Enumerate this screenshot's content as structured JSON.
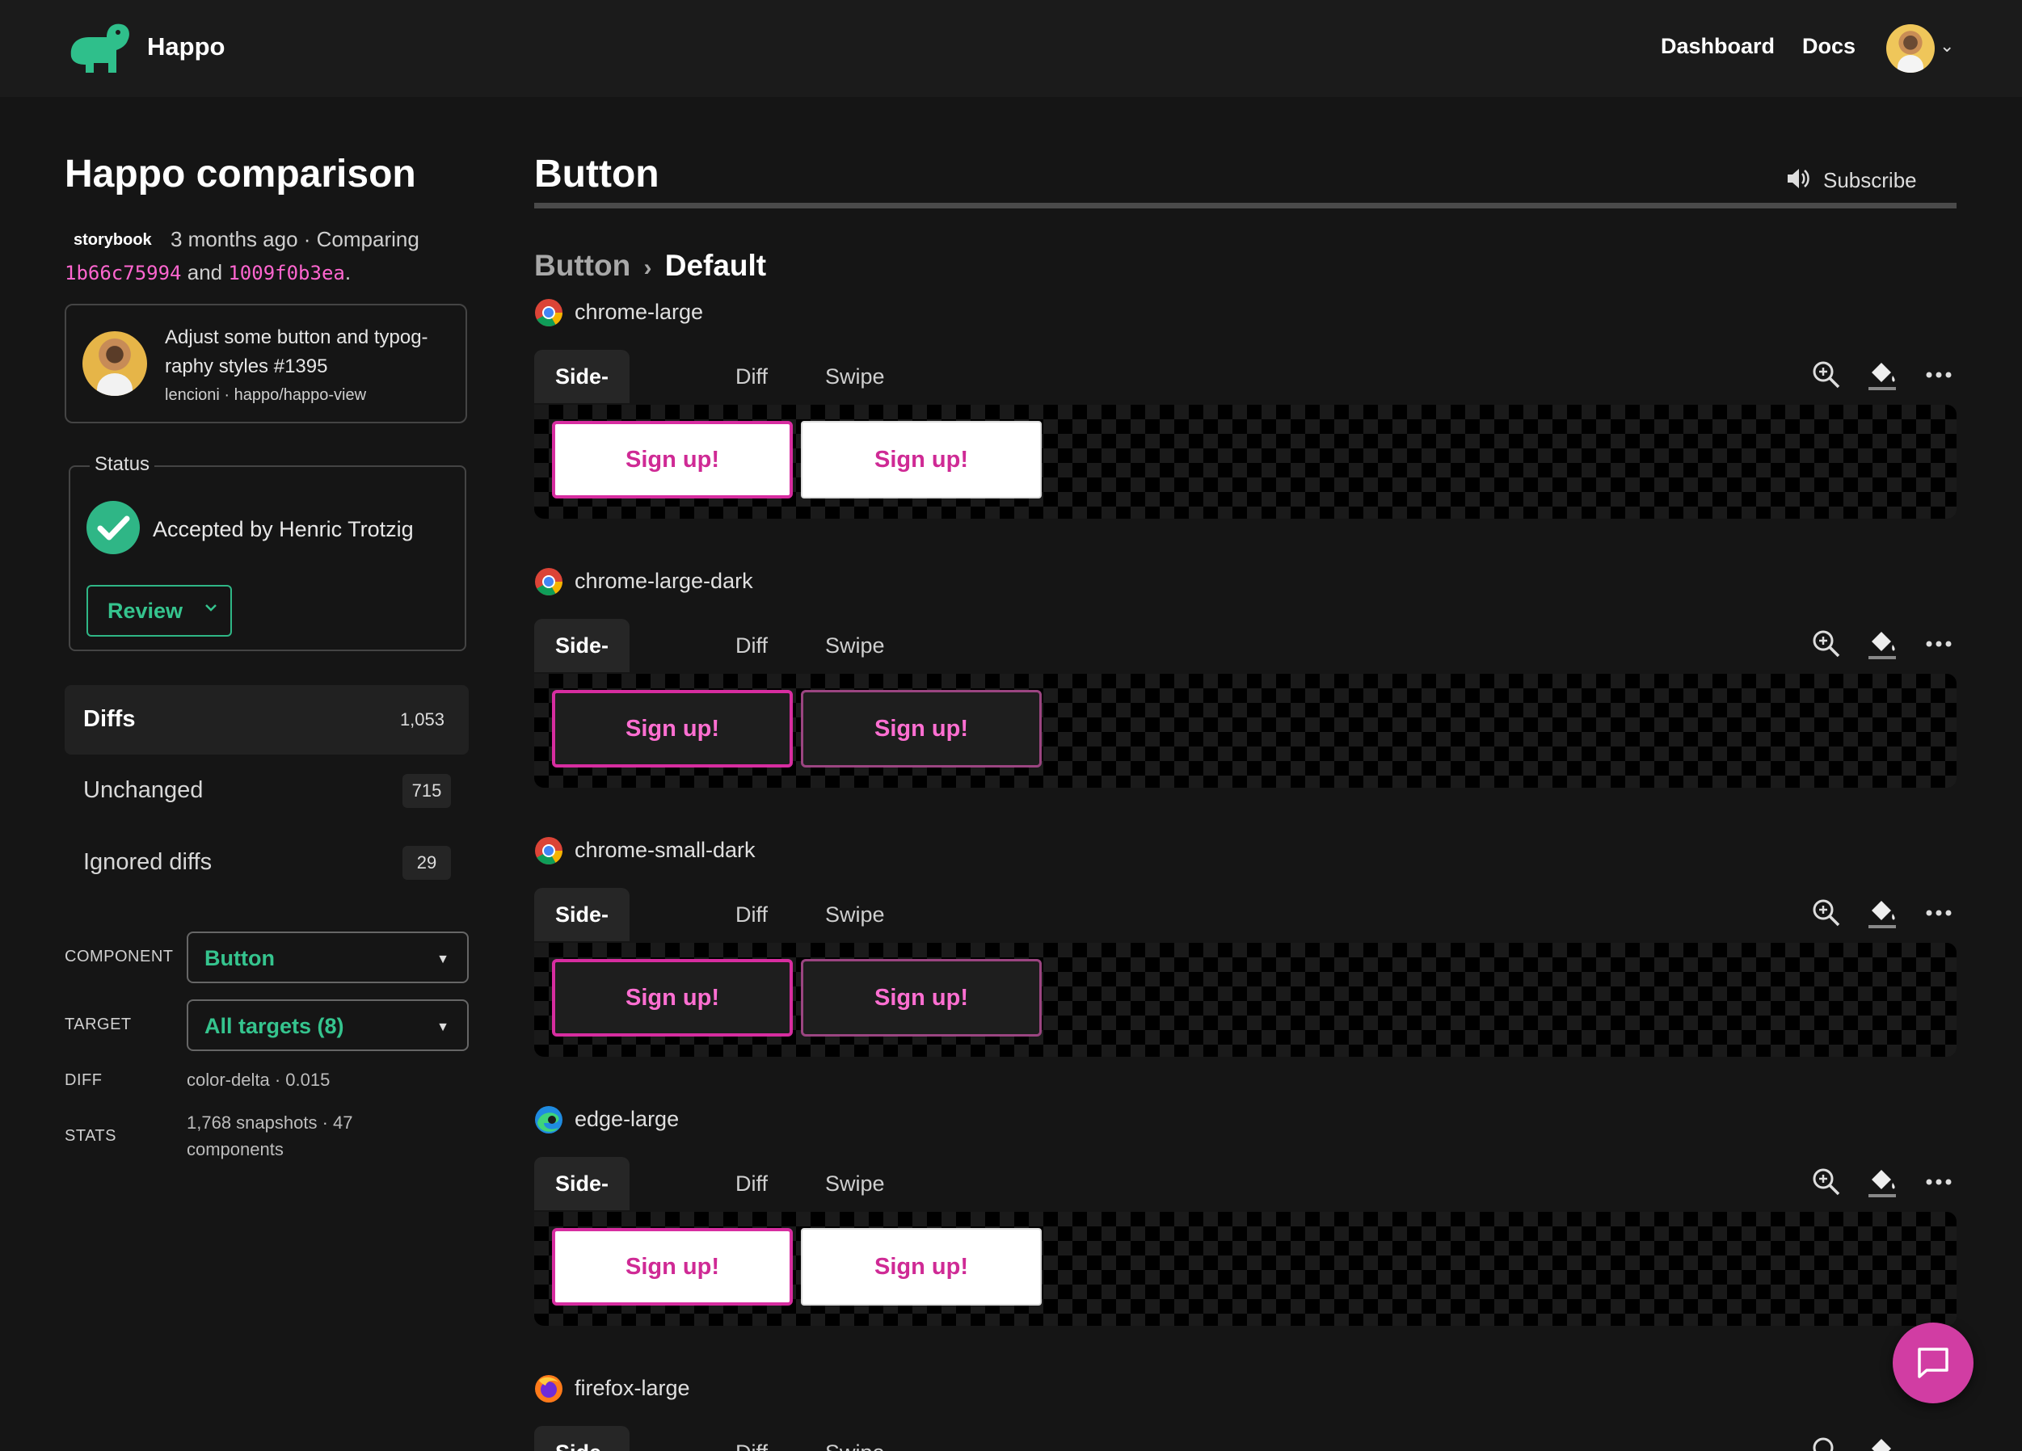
{
  "header": {
    "brand": "Happo",
    "nav": [
      "Dashboard",
      "Docs"
    ]
  },
  "sidebar": {
    "title": "Happo comparison",
    "project_badge": "storybook",
    "meta_time": "3 months ago · Comparing",
    "sha_before": "1b66c75994",
    "and_text": "and",
    "sha_after": "1009f0b3ea",
    "period": ".",
    "pr": {
      "title": "Adjust some button and typog-raphy styles #1395",
      "subtitle": "lencioni · happo/happo-view"
    },
    "status": {
      "legend": "Status",
      "text": "Accepted by Henric Trotzig",
      "review_label": "Review"
    },
    "tabs": [
      {
        "label": "Diffs",
        "count": "1,053"
      },
      {
        "label": "Unchanged",
        "count": "715"
      },
      {
        "label": "Ignored diffs",
        "count": "29"
      }
    ],
    "filters": {
      "component_label": "COMPONENT",
      "component_value": "Button",
      "target_label": "TARGET",
      "target_value": "All targets (8)",
      "diff_label": "DIFF",
      "diff_value": "color-delta · 0.015",
      "stats_label": "STATS",
      "stats_value": "1,768 snapshots · 47 components"
    }
  },
  "main": {
    "title": "Button",
    "subscribe_label": "Subscribe",
    "breadcrumb_component": "Button",
    "breadcrumb_separator": "›",
    "breadcrumb_variant": "Default",
    "view_tabs": [
      "Side-by-side",
      "Diff",
      "Swipe"
    ],
    "snapshot_text": "Sign up!",
    "targets": [
      {
        "name": "chrome-large",
        "browser": "chrome-icon",
        "theme": "light"
      },
      {
        "name": "chrome-large-dark",
        "browser": "chrome-icon",
        "theme": "dark"
      },
      {
        "name": "chrome-small-dark",
        "browser": "chrome-icon",
        "theme": "dark"
      },
      {
        "name": "edge-large",
        "browser": "edge-icon",
        "theme": "light"
      },
      {
        "name": "firefox-large",
        "browser": "firefox-icon",
        "theme": "light"
      }
    ]
  },
  "colors": {
    "accent_green": "#2fb686",
    "accent_pink": "#d72da0",
    "sha_pink": "#ff66d0"
  }
}
